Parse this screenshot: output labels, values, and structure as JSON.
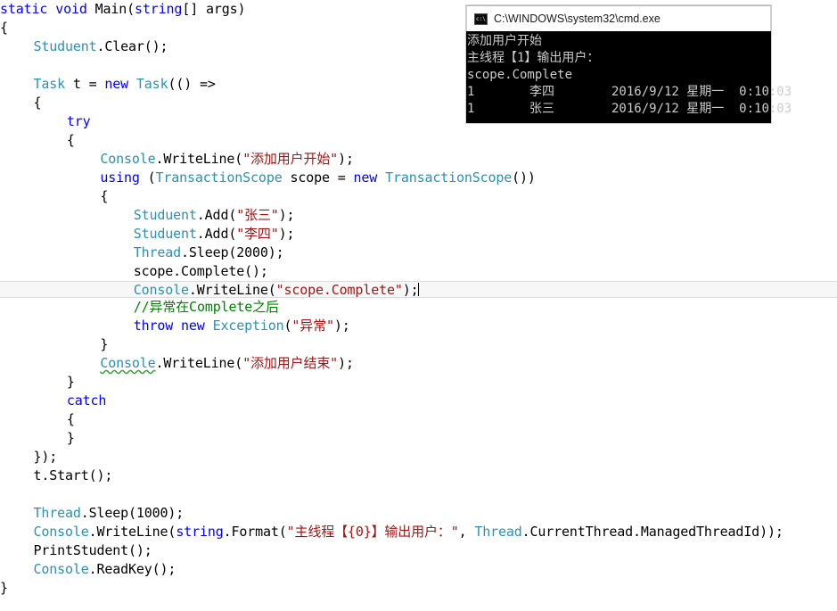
{
  "editor": {
    "current_line_index": 16,
    "colors": {
      "keyword": "#0000ff",
      "type": "#2b91af",
      "string": "#a31515",
      "comment": "#008000",
      "plain": "#000000",
      "current_line_band": "#f7f7f7",
      "squiggle": "#3c9d3c"
    },
    "lines": [
      {
        "id": "l1",
        "indent": 0,
        "tokens": [
          {
            "c": "kw",
            "t": "static"
          },
          {
            "c": "pln",
            "t": " "
          },
          {
            "c": "kw",
            "t": "void"
          },
          {
            "c": "pln",
            "t": " Main("
          },
          {
            "c": "kw",
            "t": "string"
          },
          {
            "c": "pln",
            "t": "[] args)"
          }
        ]
      },
      {
        "id": "l2",
        "indent": 0,
        "tokens": [
          {
            "c": "pln",
            "t": "{"
          }
        ]
      },
      {
        "id": "l3",
        "indent": 4,
        "tokens": [
          {
            "c": "typ",
            "t": "Studuent"
          },
          {
            "c": "pln",
            "t": ".Clear();"
          }
        ]
      },
      {
        "id": "l4",
        "indent": 0,
        "tokens": []
      },
      {
        "id": "l5",
        "indent": 4,
        "tokens": [
          {
            "c": "typ",
            "t": "Task"
          },
          {
            "c": "pln",
            "t": " t = "
          },
          {
            "c": "kw",
            "t": "new"
          },
          {
            "c": "pln",
            "t": " "
          },
          {
            "c": "typ",
            "t": "Task"
          },
          {
            "c": "pln",
            "t": "(() =>"
          }
        ]
      },
      {
        "id": "l6",
        "indent": 4,
        "tokens": [
          {
            "c": "pln",
            "t": "{"
          }
        ]
      },
      {
        "id": "l7",
        "indent": 8,
        "tokens": [
          {
            "c": "kw",
            "t": "try"
          }
        ]
      },
      {
        "id": "l8",
        "indent": 8,
        "tokens": [
          {
            "c": "pln",
            "t": "{"
          }
        ]
      },
      {
        "id": "l9",
        "indent": 12,
        "tokens": [
          {
            "c": "typ",
            "t": "Console"
          },
          {
            "c": "pln",
            "t": ".WriteLine("
          },
          {
            "c": "str",
            "t": "\"添加用户开始\""
          },
          {
            "c": "pln",
            "t": ");"
          }
        ]
      },
      {
        "id": "l10",
        "indent": 12,
        "tokens": [
          {
            "c": "kw",
            "t": "using"
          },
          {
            "c": "pln",
            "t": " ("
          },
          {
            "c": "typ",
            "t": "TransactionScope"
          },
          {
            "c": "pln",
            "t": " scope = "
          },
          {
            "c": "kw",
            "t": "new"
          },
          {
            "c": "pln",
            "t": " "
          },
          {
            "c": "typ",
            "t": "TransactionScope"
          },
          {
            "c": "pln",
            "t": "())"
          }
        ]
      },
      {
        "id": "l11",
        "indent": 12,
        "tokens": [
          {
            "c": "pln",
            "t": "{"
          }
        ]
      },
      {
        "id": "l12",
        "indent": 16,
        "tokens": [
          {
            "c": "typ",
            "t": "Studuent"
          },
          {
            "c": "pln",
            "t": ".Add("
          },
          {
            "c": "str",
            "t": "\"张三\""
          },
          {
            "c": "pln",
            "t": ");"
          }
        ]
      },
      {
        "id": "l13",
        "indent": 16,
        "tokens": [
          {
            "c": "typ",
            "t": "Studuent"
          },
          {
            "c": "pln",
            "t": ".Add("
          },
          {
            "c": "str",
            "t": "\"李四\""
          },
          {
            "c": "pln",
            "t": ");"
          }
        ]
      },
      {
        "id": "l14",
        "indent": 16,
        "tokens": [
          {
            "c": "typ",
            "t": "Thread"
          },
          {
            "c": "pln",
            "t": ".Sleep(2000);"
          }
        ]
      },
      {
        "id": "l15",
        "indent": 16,
        "tokens": [
          {
            "c": "pln",
            "t": "scope.Complete();"
          }
        ]
      },
      {
        "id": "l16",
        "indent": 16,
        "current": true,
        "caret": true,
        "tokens": [
          {
            "c": "typ",
            "t": "Console"
          },
          {
            "c": "pln",
            "t": ".WriteLine("
          },
          {
            "c": "str",
            "t": "\"scope.Complete\""
          },
          {
            "c": "pln",
            "t": ");"
          }
        ]
      },
      {
        "id": "l17",
        "indent": 16,
        "tokens": [
          {
            "c": "cmt",
            "t": "//异常在Complete之后"
          }
        ]
      },
      {
        "id": "l18",
        "indent": 16,
        "tokens": [
          {
            "c": "kw",
            "t": "throw"
          },
          {
            "c": "pln",
            "t": " "
          },
          {
            "c": "kw",
            "t": "new"
          },
          {
            "c": "pln",
            "t": " "
          },
          {
            "c": "typ",
            "t": "Exception"
          },
          {
            "c": "pln",
            "t": "("
          },
          {
            "c": "str",
            "t": "\"异常\""
          },
          {
            "c": "pln",
            "t": ");"
          }
        ]
      },
      {
        "id": "l19",
        "indent": 12,
        "tokens": [
          {
            "c": "pln",
            "t": "}"
          }
        ]
      },
      {
        "id": "l20",
        "indent": 12,
        "tokens": [
          {
            "c": "typ sqg",
            "t": "Console"
          },
          {
            "c": "pln",
            "t": ".WriteLine("
          },
          {
            "c": "str",
            "t": "\"添加用户结束\""
          },
          {
            "c": "pln",
            "t": ");"
          }
        ]
      },
      {
        "id": "l21",
        "indent": 8,
        "tokens": [
          {
            "c": "pln",
            "t": "}"
          }
        ]
      },
      {
        "id": "l22",
        "indent": 8,
        "tokens": [
          {
            "c": "kw",
            "t": "catch"
          }
        ]
      },
      {
        "id": "l23",
        "indent": 8,
        "tokens": [
          {
            "c": "pln",
            "t": "{"
          }
        ]
      },
      {
        "id": "l24",
        "indent": 8,
        "tokens": [
          {
            "c": "pln",
            "t": "}"
          }
        ]
      },
      {
        "id": "l25",
        "indent": 4,
        "tokens": [
          {
            "c": "pln",
            "t": "});"
          }
        ]
      },
      {
        "id": "l26",
        "indent": 4,
        "tokens": [
          {
            "c": "pln",
            "t": "t.Start();"
          }
        ]
      },
      {
        "id": "l27",
        "indent": 0,
        "tokens": []
      },
      {
        "id": "l28",
        "indent": 4,
        "tokens": [
          {
            "c": "typ",
            "t": "Thread"
          },
          {
            "c": "pln",
            "t": ".Sleep(1000);"
          }
        ]
      },
      {
        "id": "l29",
        "indent": 4,
        "tokens": [
          {
            "c": "typ",
            "t": "Console"
          },
          {
            "c": "pln",
            "t": ".WriteLine("
          },
          {
            "c": "kw",
            "t": "string"
          },
          {
            "c": "pln",
            "t": ".Format("
          },
          {
            "c": "str",
            "t": "\"主线程【{0}】输出用户："
          },
          {
            "c": "str",
            "t": "\""
          },
          {
            "c": "pln",
            "t": ", "
          },
          {
            "c": "typ",
            "t": "Thread"
          },
          {
            "c": "pln",
            "t": ".CurrentThread.ManagedThreadId));"
          }
        ]
      },
      {
        "id": "l30",
        "indent": 4,
        "tokens": [
          {
            "c": "pln",
            "t": "PrintStudent();"
          }
        ]
      },
      {
        "id": "l31",
        "indent": 4,
        "tokens": [
          {
            "c": "typ",
            "t": "Console"
          },
          {
            "c": "pln",
            "t": ".ReadKey();"
          }
        ]
      },
      {
        "id": "l32",
        "indent": 0,
        "tokens": [
          {
            "c": "pln",
            "t": "}"
          }
        ]
      }
    ]
  },
  "console_window": {
    "icon": "cmd-icon",
    "title": "C:\\WINDOWS\\system32\\cmd.exe",
    "output_lines": [
      "添加用户开始",
      "主线程【1】输出用户：",
      "scope.Complete"
    ],
    "table_rows": [
      {
        "id": "1",
        "name": "李四",
        "date": "2016/9/12 星期一",
        "time": "0:10:03"
      },
      {
        "id": "1",
        "name": "张三",
        "date": "2016/9/12 星期一",
        "time": "0:10:03"
      }
    ]
  }
}
